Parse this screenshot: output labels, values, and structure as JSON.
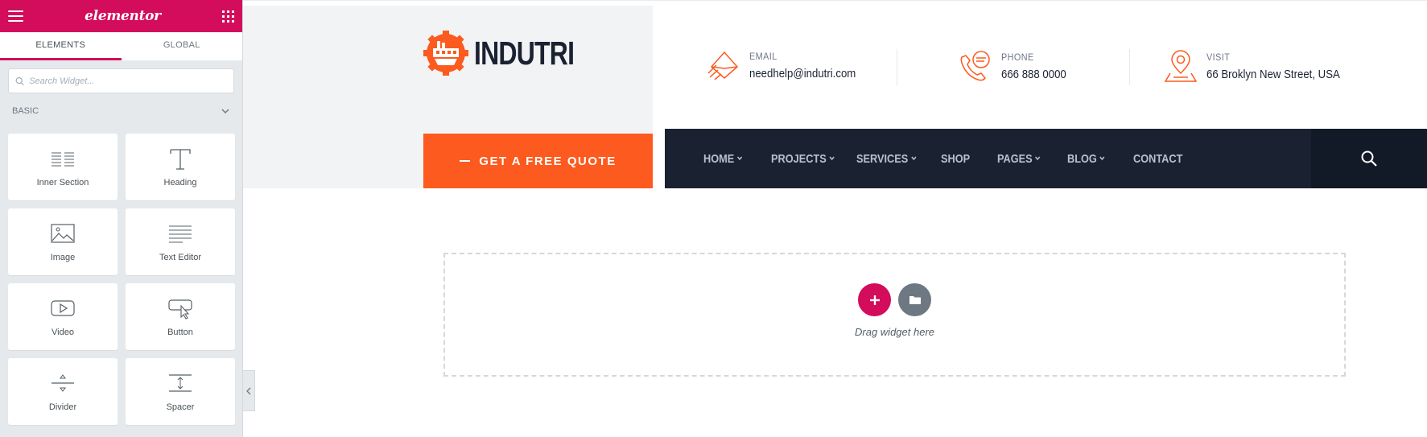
{
  "editor": {
    "brand": "elementor",
    "tabs": [
      {
        "label": "ELEMENTS",
        "active": true
      },
      {
        "label": "GLOBAL",
        "active": false
      }
    ],
    "search": {
      "placeholder": "Search Widget..."
    },
    "category": "BASIC",
    "widgets": [
      {
        "label": "Inner Section",
        "icon": "inner-section-icon"
      },
      {
        "label": "Heading",
        "icon": "heading-icon"
      },
      {
        "label": "Image",
        "icon": "image-icon"
      },
      {
        "label": "Text Editor",
        "icon": "text-editor-icon"
      },
      {
        "label": "Video",
        "icon": "video-icon"
      },
      {
        "label": "Button",
        "icon": "button-icon"
      },
      {
        "label": "Divider",
        "icon": "divider-icon"
      },
      {
        "label": "Spacer",
        "icon": "spacer-icon"
      }
    ],
    "accent_color": "#d30c5c"
  },
  "site": {
    "logo_text": "INDUTRI",
    "quote_button": "GET A FREE QUOTE",
    "contacts": [
      {
        "label": "EMAIL",
        "value": "needhelp@indutri.com",
        "icon": "envelope-icon"
      },
      {
        "label": "PHONE",
        "value": "666 888 0000",
        "icon": "phone-chat-icon"
      },
      {
        "label": "VISIT",
        "value": "66 Broklyn New Street, USA",
        "icon": "map-pin-icon"
      }
    ],
    "nav": [
      {
        "label": "HOME",
        "dropdown": true
      },
      {
        "label": "PROJECTS",
        "dropdown": true
      },
      {
        "label": "SERVICES",
        "dropdown": true
      },
      {
        "label": "SHOP",
        "dropdown": false
      },
      {
        "label": "PAGES",
        "dropdown": true
      },
      {
        "label": "BLOG",
        "dropdown": true
      },
      {
        "label": "CONTACT",
        "dropdown": false
      }
    ],
    "brand_color": "#fc5a1e",
    "nav_color": "#1a2232"
  },
  "dropzone": {
    "hint": "Drag widget here"
  }
}
